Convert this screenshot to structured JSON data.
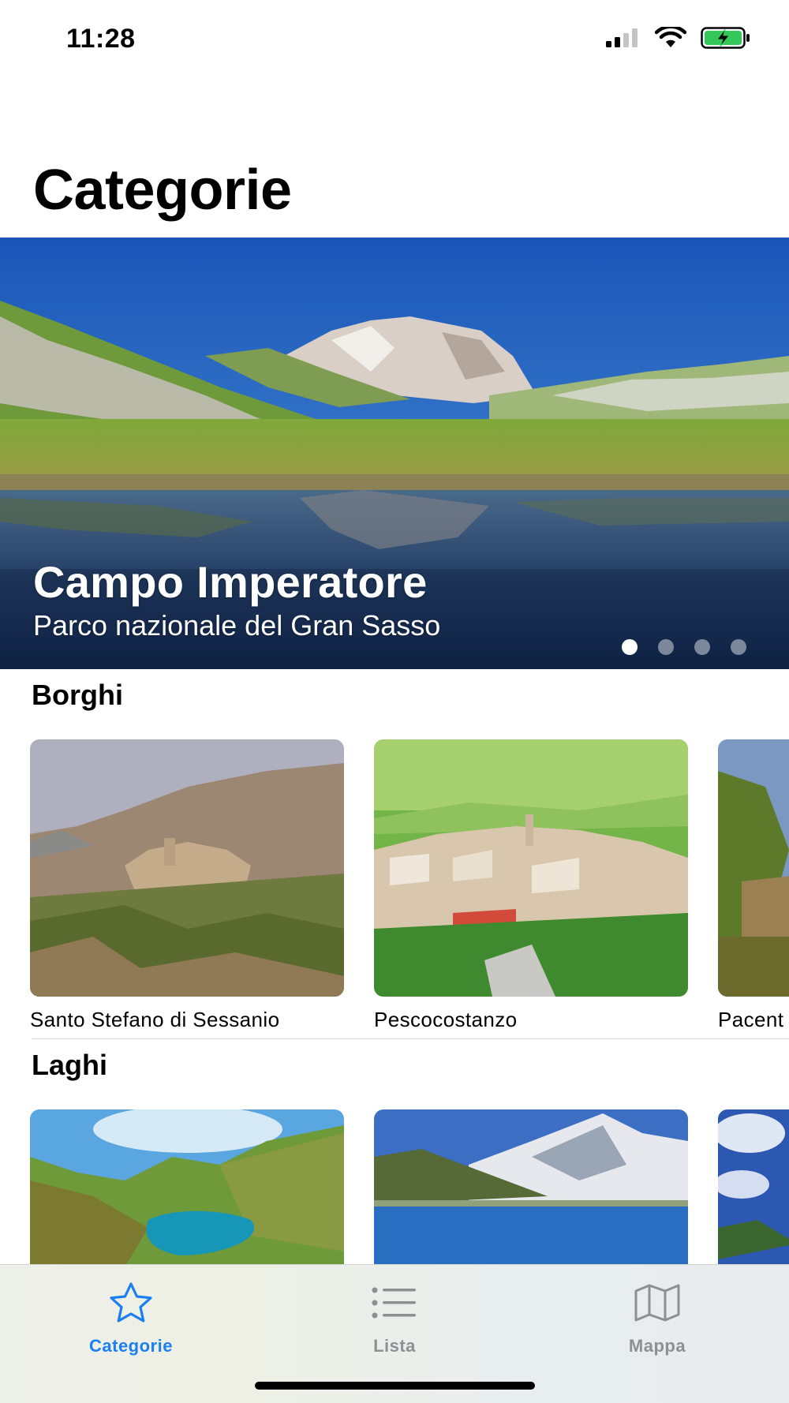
{
  "status_bar": {
    "time": "11:28"
  },
  "page": {
    "title": "Categorie"
  },
  "hero": {
    "title": "Campo Imperatore",
    "subtitle": "Parco nazionale del Gran Sasso",
    "page_count": 4,
    "current_page": 1
  },
  "sections": [
    {
      "title": "Borghi",
      "items": [
        {
          "label": "Santo Stefano di Sessanio"
        },
        {
          "label": "Pescocostanzo"
        },
        {
          "label": "Pacent"
        }
      ]
    },
    {
      "title": "Laghi",
      "items": [
        {
          "label": ""
        },
        {
          "label": ""
        },
        {
          "label": ""
        }
      ]
    }
  ],
  "tab_bar": {
    "tabs": [
      {
        "label": "Categorie",
        "icon": "star-icon",
        "active": true
      },
      {
        "label": "Lista",
        "icon": "list-icon",
        "active": false
      },
      {
        "label": "Mappa",
        "icon": "map-icon",
        "active": false
      }
    ]
  },
  "colors": {
    "accent": "#1a7ff0",
    "inactive": "#8e8e93",
    "battery": "#34c759"
  }
}
